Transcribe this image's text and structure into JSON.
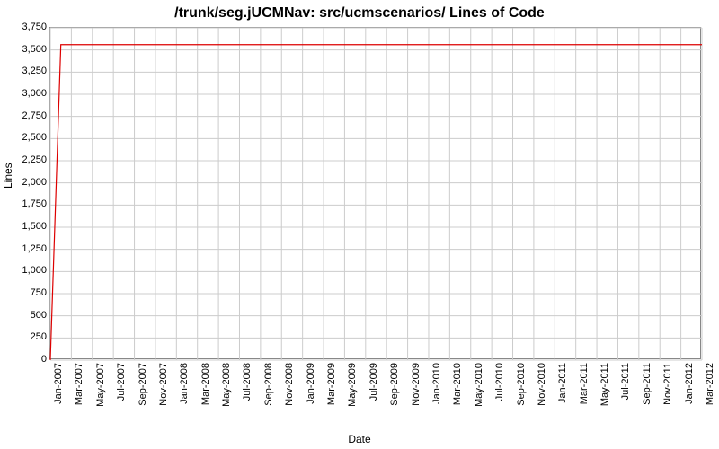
{
  "chart_data": {
    "type": "line",
    "title": "/trunk/seg.jUCMNav: src/ucmscenarios/ Lines of Code",
    "xlabel": "Date",
    "ylabel": "Lines",
    "ylim": [
      0,
      3750
    ],
    "yticks": [
      0,
      250,
      500,
      750,
      1000,
      1250,
      1500,
      1750,
      2000,
      2250,
      2500,
      2750,
      3000,
      3250,
      3500,
      3750
    ],
    "categories": [
      "Jan-2007",
      "Mar-2007",
      "May-2007",
      "Jul-2007",
      "Sep-2007",
      "Nov-2007",
      "Jan-2008",
      "Mar-2008",
      "May-2008",
      "Jul-2008",
      "Sep-2008",
      "Nov-2008",
      "Jan-2009",
      "Mar-2009",
      "May-2009",
      "Jul-2009",
      "Sep-2009",
      "Nov-2009",
      "Jan-2010",
      "Mar-2010",
      "May-2010",
      "Jul-2010",
      "Sep-2010",
      "Nov-2010",
      "Jan-2011",
      "Mar-2011",
      "May-2011",
      "Jul-2011",
      "Sep-2011",
      "Nov-2011",
      "Jan-2012",
      "Mar-2012"
    ],
    "series": [
      {
        "name": "Lines of Code",
        "color": "#dd0000",
        "x": [
          "Jan-2007",
          "Feb-2007",
          "Mar-2007",
          "May-2007",
          "Jul-2007",
          "Sep-2007",
          "Nov-2007",
          "Jan-2008",
          "Mar-2008",
          "May-2008",
          "Jul-2008",
          "Sep-2008",
          "Nov-2008",
          "Jan-2009",
          "Mar-2009",
          "May-2009",
          "Jul-2009",
          "Sep-2009",
          "Nov-2009",
          "Jan-2010",
          "Mar-2010",
          "May-2010",
          "Jul-2010",
          "Sep-2010",
          "Nov-2010",
          "Jan-2011",
          "Mar-2011",
          "May-2011",
          "Jul-2011",
          "Sep-2011",
          "Nov-2011",
          "Jan-2012",
          "Mar-2012"
        ],
        "values": [
          0,
          3560,
          3560,
          3560,
          3560,
          3560,
          3560,
          3560,
          3560,
          3560,
          3560,
          3560,
          3560,
          3560,
          3560,
          3560,
          3560,
          3560,
          3560,
          3560,
          3560,
          3560,
          3560,
          3560,
          3560,
          3560,
          3560,
          3560,
          3560,
          3560,
          3560,
          3560,
          3560
        ]
      }
    ]
  }
}
